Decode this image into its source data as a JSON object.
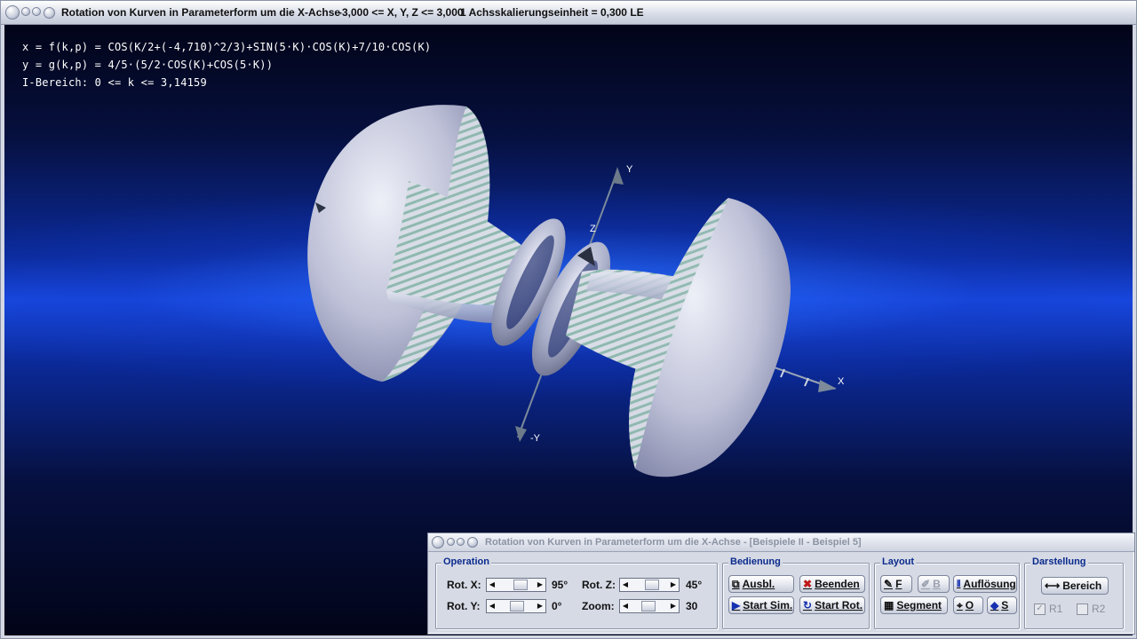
{
  "window": {
    "title": "Rotation von Kurven in Parameterform um die X-Achse",
    "range": "-3,000 <= X, Y, Z <= 3,000",
    "scale": "1 Achsskalierungseinheit = 0,300 LE"
  },
  "formulas": {
    "x": "x = f(k,p) = COS(K/2+(-4,710)^2/3)+SIN(5·K)·COS(K)+7/10·COS(K)",
    "y": "y = g(k,p) = 4/5·(5/2·COS(K)+COS(5·K))",
    "range": "I-Bereich: 0 <= k <= 3,14159"
  },
  "axes": {
    "x": "X",
    "y": "Y",
    "neg_y": "-Y",
    "z": "Z"
  },
  "panel": {
    "title": "Rotation von Kurven in Parameterform um die X-Achse - [Beispiele II - Beispiel 5]",
    "operation": {
      "title": "Operation",
      "rot_x_label": "Rot. X:",
      "rot_x_value": "95°",
      "rot_y_label": "Rot. Y:",
      "rot_y_value": "0°",
      "rot_z_label": "Rot. Z:",
      "rot_z_value": "45°",
      "zoom_label": "Zoom:",
      "zoom_value": "30"
    },
    "bedienung": {
      "title": "Bedienung",
      "ausbl": "Ausbl.",
      "beenden": "Beenden",
      "start_sim": "Start Sim.",
      "start_rot": "Start Rot."
    },
    "layout": {
      "title": "Layout",
      "f": "F",
      "b": "B",
      "aufloesung": "Auflösung",
      "segment": "Segment",
      "o": "O",
      "s": "S"
    },
    "darstellung": {
      "title": "Darstellung",
      "bereich": "Bereich",
      "r1": "R1",
      "r2": "R2"
    }
  },
  "colors": {
    "accent": "#0a2a8c",
    "surface": "#c8c8dc",
    "stripe": "#8fb9b0"
  }
}
